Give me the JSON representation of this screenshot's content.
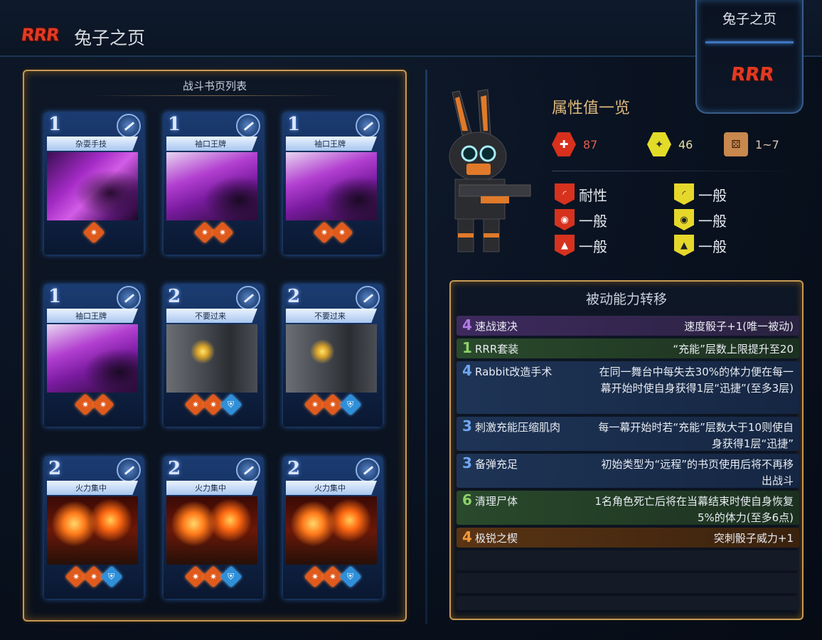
{
  "header": {
    "logo_text": "RRR",
    "title": "兔子之页"
  },
  "corner_tab": {
    "label": "兔子之页",
    "logo_text": "RRR"
  },
  "card_panel": {
    "title": "战斗书页列表",
    "cards": [
      {
        "cost": "1",
        "name": "杂耍手技",
        "art": "purple",
        "dice": [
          "atk"
        ]
      },
      {
        "cost": "1",
        "name": "袖口王牌",
        "art": "pink",
        "dice": [
          "atk",
          "atk"
        ]
      },
      {
        "cost": "1",
        "name": "袖口王牌",
        "art": "pink",
        "dice": [
          "atk",
          "atk"
        ]
      },
      {
        "cost": "1",
        "name": "袖口王牌",
        "art": "pink",
        "dice": [
          "atk",
          "atk"
        ]
      },
      {
        "cost": "2",
        "name": "不要过来",
        "art": "gray",
        "dice": [
          "atk",
          "atk",
          "def"
        ]
      },
      {
        "cost": "2",
        "name": "不要过来",
        "art": "gray",
        "dice": [
          "atk",
          "atk",
          "def"
        ]
      },
      {
        "cost": "2",
        "name": "火力集中",
        "art": "fire",
        "dice": [
          "atk",
          "atk",
          "def"
        ]
      },
      {
        "cost": "2",
        "name": "火力集中",
        "art": "fire",
        "dice": [
          "atk",
          "atk",
          "def"
        ]
      },
      {
        "cost": "2",
        "name": "火力集中",
        "art": "fire",
        "dice": [
          "atk",
          "atk",
          "def"
        ]
      }
    ]
  },
  "stats": {
    "title": "属性值一览",
    "hp": "87",
    "stagger": "46",
    "speed": "1~7"
  },
  "resistances": {
    "hp": [
      "耐性",
      "一般",
      "一般"
    ],
    "stagger": [
      "一般",
      "一般",
      "一般"
    ]
  },
  "passives": {
    "title": "被动能力转移",
    "items": [
      {
        "cost": "4",
        "name": "速战速决",
        "desc": "速度骰子+1(唯一被动)",
        "color": "purple"
      },
      {
        "cost": "1",
        "name": "RRR套装",
        "desc": "“充能”层数上限提升至20",
        "color": "green"
      },
      {
        "cost": "4",
        "name": "Rabbit改造手术",
        "desc": "在同一舞台中每失去30%的体力便在每一幕开始时使自身获得1层“迅捷”(至多3层)",
        "color": "blue"
      },
      {
        "cost": "3",
        "name": "刺激充能压缩肌肉",
        "desc": "每一幕开始时若“充能”层数大于10则使自身获得1层“迅捷”",
        "color": "blue"
      },
      {
        "cost": "3",
        "name": "备弹充足",
        "desc": "初始类型为“远程”的书页使用后将不再移出战斗",
        "color": "blue"
      },
      {
        "cost": "6",
        "name": "清理尸体",
        "desc": "1名角色死亡后将在当幕结束时使自身恢复5%的体力(至多6点)",
        "color": "green"
      },
      {
        "cost": "4",
        "name": "极锐之楔",
        "desc": "突刺骰子威力+1",
        "color": "orange"
      }
    ]
  }
}
